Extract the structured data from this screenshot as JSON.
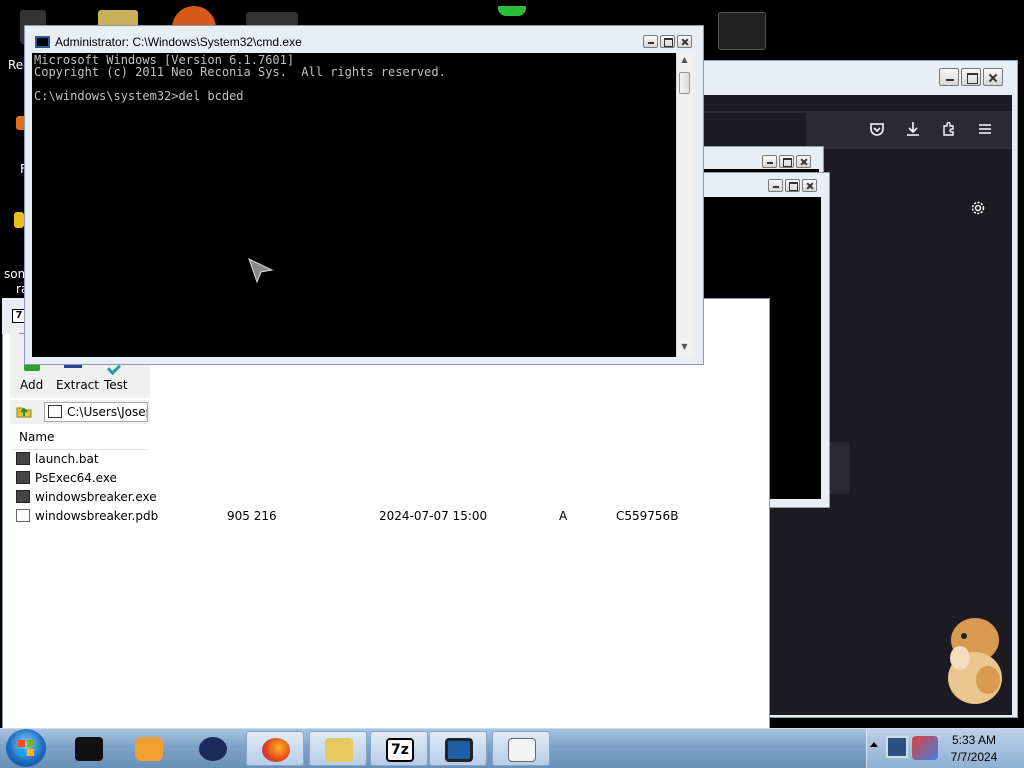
{
  "desktop": {
    "label_rec": "Rec",
    "label_f": "F",
    "label_som": "som",
    "label_ra": "ra"
  },
  "cmd": {
    "title": "Administrator: C:\\Windows\\System32\\cmd.exe",
    "console_lines": "Microsoft Windows [Version 6.1.7601]\nCopyright (c) 2011 Neo Reconia Sys.  All rights reserved.\n\nC:\\windows\\system32>del bcded"
  },
  "sevenzip": {
    "title_letter": "7",
    "menu_partial": "F",
    "toolbar": {
      "add": "Add",
      "extract": "Extract",
      "test": "Test"
    },
    "path": "C:\\Users\\Josep",
    "column_name": "Name",
    "files": [
      {
        "name": "launch.bat",
        "icon": "batch-file-icon"
      },
      {
        "name": "PsExec64.exe",
        "icon": "exe-file-icon"
      },
      {
        "name": "windowsbreaker.exe",
        "icon": "exe-file-icon"
      },
      {
        "name": "windowsbreaker.pdb",
        "icon": "document-file-icon",
        "size": "905 216",
        "modified": "2024-07-07 15:00",
        "attributes": "A",
        "crc": "C559756B"
      }
    ]
  },
  "firefox": {
    "icons": [
      "pocket-icon",
      "download-icon",
      "extensions-icon",
      "menu-icon",
      "settings-gear-icon"
    ]
  },
  "taskbar": {
    "items": [
      "cmd-app-icon",
      "media-player-icon",
      "globe-app-icon",
      "firefox-icon",
      "explorer-folder-icon",
      "7zip-icon",
      "monitor-app-icon",
      "notepad-icon"
    ],
    "zip_label": "7z",
    "time": "5:33 AM",
    "date": "7/7/2024"
  }
}
